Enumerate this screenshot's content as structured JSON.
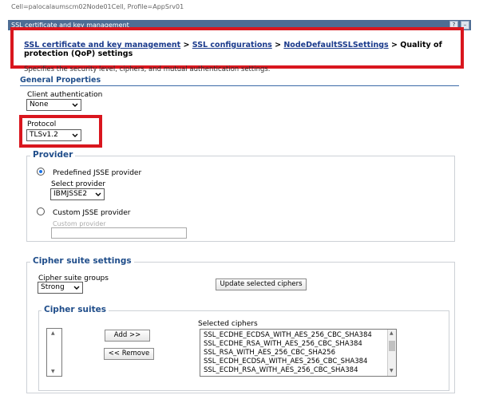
{
  "header": {
    "scope_text": "Cell=palocalaumscm02Node01Cell, Profile=AppSrv01",
    "panel_title": "SSL certificate and key management",
    "help_btn": "?",
    "min_btn": "–"
  },
  "breadcrumb": {
    "link1": "SSL certificate and key management",
    "link2": "SSL configurations",
    "link3": "NodeDefaultSSLSettings",
    "sep": " > ",
    "current": "Quality of protection (QoP) settings"
  },
  "description": "Specifies the security level, ciphers, and mutual authentication settings.",
  "general": {
    "title": "General Properties",
    "client_auth_label": "Client authentication",
    "client_auth_value": "None",
    "protocol_label": "Protocol",
    "protocol_value": "TLSv1.2"
  },
  "provider": {
    "title": "Provider",
    "predefined_label": "Predefined JSSE provider",
    "select_label": "Select provider",
    "select_value": "IBMJSSE2",
    "custom_label": "Custom JSSE provider",
    "custom_field_label": "Custom provider"
  },
  "cipher_settings": {
    "title": "Cipher suite settings",
    "groups_label": "Cipher suite groups",
    "groups_value": "Strong",
    "update_button": "Update selected ciphers"
  },
  "cipher_suites": {
    "title": "Cipher suites",
    "add_button": "Add >>",
    "remove_button": "<< Remove",
    "selected_label": "Selected ciphers",
    "selected": [
      "SSL_ECDHE_ECDSA_WITH_AES_256_CBC_SHA384",
      "SSL_ECDHE_RSA_WITH_AES_256_CBC_SHA384",
      "SSL_RSA_WITH_AES_256_CBC_SHA256",
      "SSL_ECDH_ECDSA_WITH_AES_256_CBC_SHA384",
      "SSL_ECDH_RSA_WITH_AES_256_CBC_SHA384"
    ]
  },
  "colors": {
    "highlight_red": "#d9161e",
    "section_blue": "#1f4d8a",
    "link_blue": "#1a3a8c",
    "titlebar": "#4e6d94"
  }
}
